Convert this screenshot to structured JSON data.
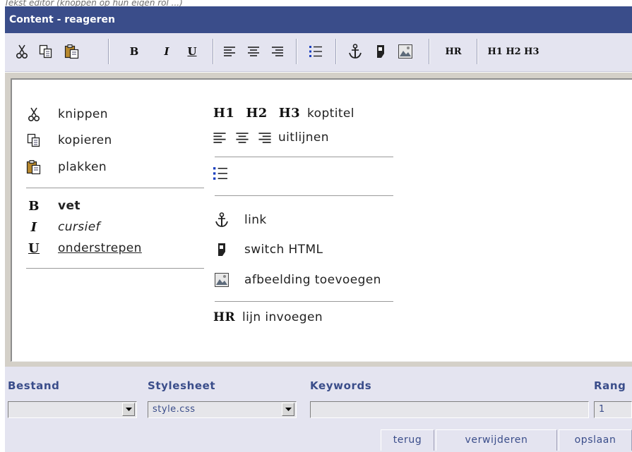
{
  "caption": "Tekst editor (knoppen op hun eigen rol ...)",
  "title": "Content - reageren",
  "toolbar": {
    "heading_label": "H1 H2 H3",
    "hr_label": "HR",
    "bold_label": "B",
    "italic_label": "I",
    "underline_label": "U"
  },
  "legend": {
    "cut": "knippen",
    "copy": "kopieren",
    "paste": "plakken",
    "bold_glyph": "B",
    "bold": "vet",
    "italic_glyph": "I",
    "italic": "cursief",
    "underline_glyph": "U",
    "underline": "onderstrepen",
    "h1": "H1",
    "h2": "H2",
    "h3": "H3",
    "heading": "koptitel",
    "align": "uitlijnen",
    "link": "link",
    "switch_html": "switch HTML",
    "image": "afbeelding toevoegen",
    "hr_glyph": "HR",
    "hr": "lijn invoegen"
  },
  "footer": {
    "bestand_label": "Bestand",
    "bestand_value": "",
    "stylesheet_label": "Stylesheet",
    "stylesheet_value": "style.css",
    "keywords_label": "Keywords",
    "keywords_value": "",
    "rang_label": "Rang",
    "rang_value": "1",
    "back_button": "terug",
    "delete_button": "verwijderen",
    "save_button": "opslaan"
  },
  "colors": {
    "accent": "#3a4d8a",
    "toolbar_bg": "#e4e4f0",
    "editor_frame": "#d4d0c8"
  }
}
